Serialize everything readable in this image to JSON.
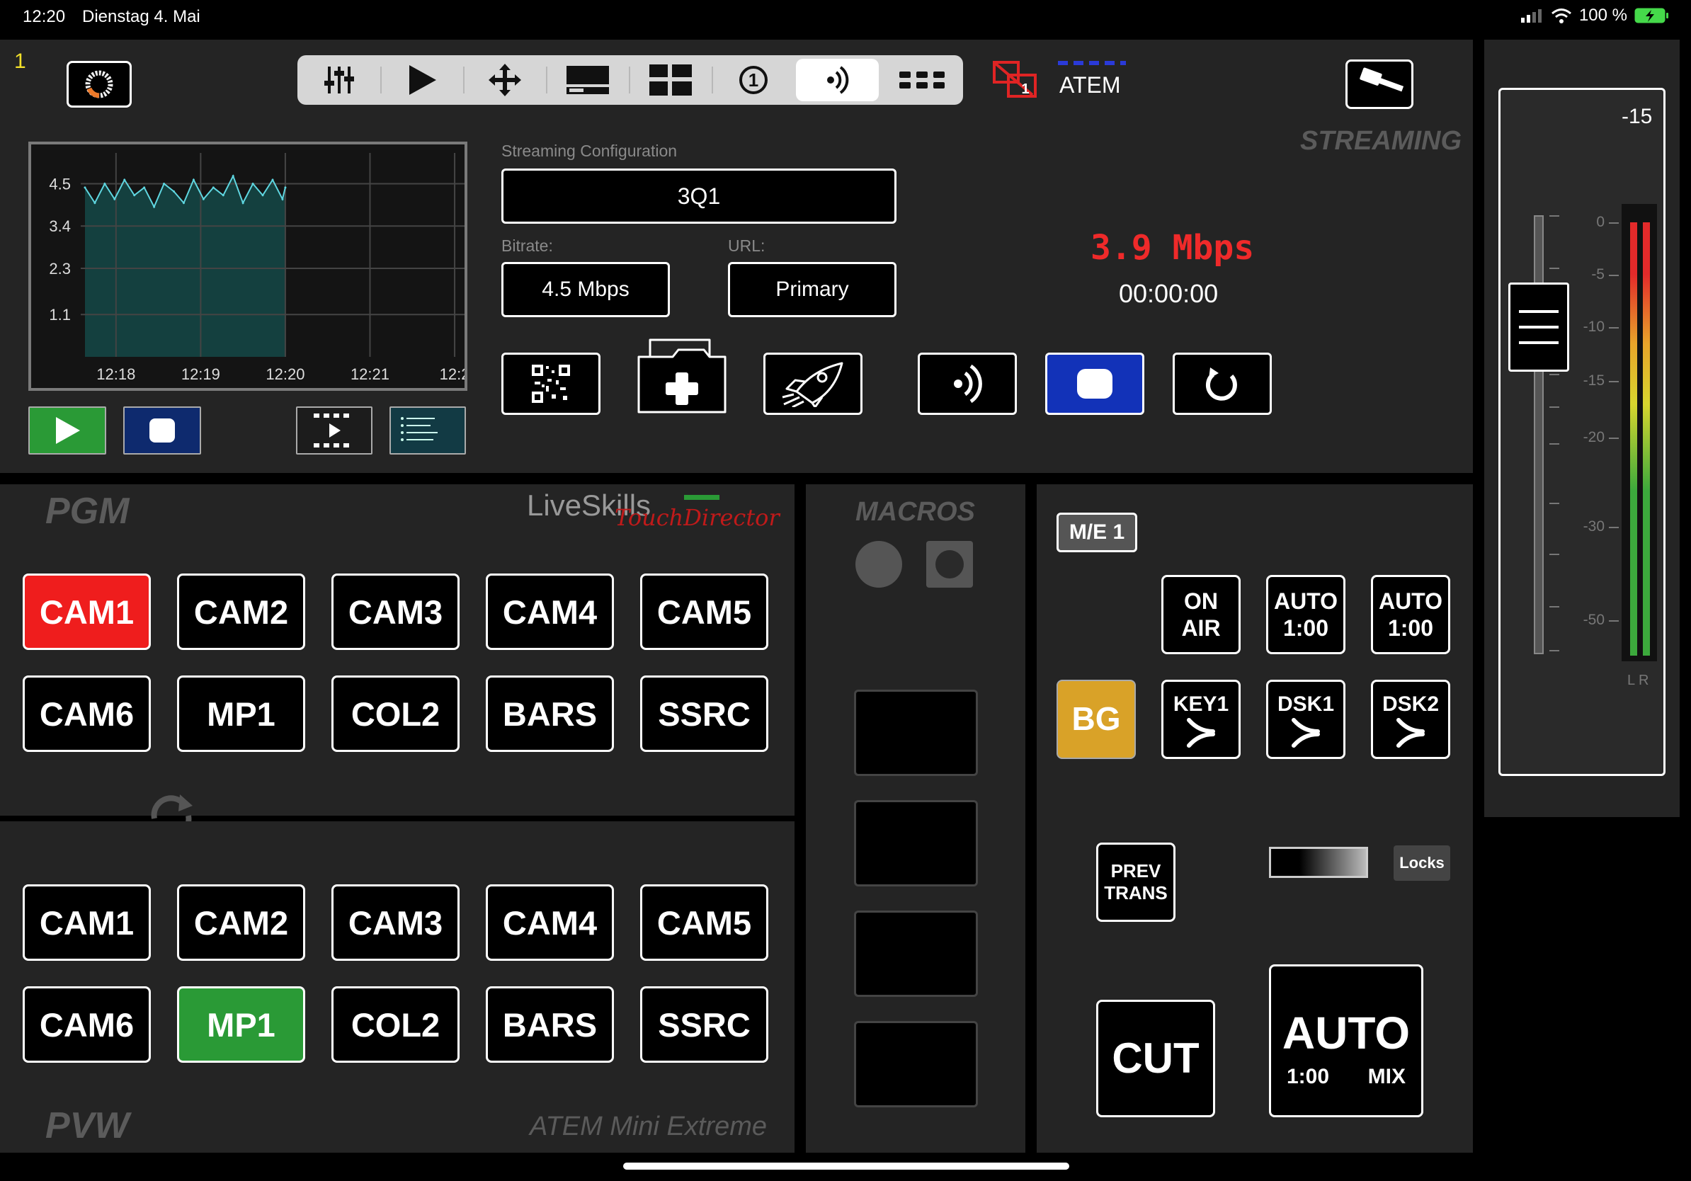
{
  "status_bar": {
    "time": "12:20",
    "date": "Dienstag 4. Mai",
    "battery": "100 %"
  },
  "top": {
    "page_number": "1",
    "device_name": "ATEM",
    "device_badge": "1",
    "section_title": "STREAMING"
  },
  "toolbar": {
    "items": [
      "mixer-icon",
      "play-icon",
      "move-icon",
      "monitor-icon",
      "multiview-icon",
      "one-circle-icon",
      "stream-icon",
      "more-icon"
    ],
    "active": "stream-icon",
    "one_label": "1"
  },
  "chart_data": {
    "type": "area",
    "title": "",
    "xlabel": "",
    "ylabel": "",
    "y_ticks": [
      "4.5",
      "3.4",
      "2.3",
      "1.1"
    ],
    "x_ticks": [
      "12:18",
      "12:19",
      "12:20",
      "12:21",
      "12:2"
    ],
    "ylim": [
      0,
      5.3
    ],
    "xlim": [
      "12:17:35",
      "12:22:05"
    ],
    "grid": true,
    "color": "#5fd6e0",
    "fill": "#14403f",
    "series": [
      {
        "x": [
          "12:17:38",
          "12:17:45",
          "12:17:52",
          "12:17:59",
          "12:18:06",
          "12:18:13",
          "12:18:20",
          "12:18:27",
          "12:18:34",
          "12:18:41",
          "12:18:48",
          "12:18:55",
          "12:19:02",
          "12:19:09",
          "12:19:16",
          "12:19:23",
          "12:19:30",
          "12:19:37",
          "12:19:44",
          "12:19:51",
          "12:19:58",
          "12:20:00"
        ],
        "values": [
          4.4,
          4.0,
          4.5,
          4.1,
          4.6,
          4.2,
          4.4,
          3.9,
          4.5,
          4.3,
          4.0,
          4.6,
          4.1,
          4.4,
          4.2,
          4.7,
          4.0,
          4.5,
          4.2,
          4.6,
          4.1,
          4.4
        ]
      }
    ]
  },
  "stream": {
    "config_label": "Streaming Configuration",
    "config_value": "3Q1",
    "bitrate_label": "Bitrate:",
    "bitrate_value": "4.5 Mbps",
    "url_label": "URL:",
    "url_value": "Primary",
    "current_rate": "3.9 Mbps",
    "duration": "00:00:00"
  },
  "colors": {
    "tally_red": "#ef1d1d",
    "preview_green": "#2a9a36",
    "bg_gold": "#d9a228",
    "record_blue": "#1232b8",
    "play_green": "#2a9a36"
  },
  "pgm": {
    "title": "PGM",
    "brand_main": "LiveSkills",
    "brand_sub": "TouchDirector",
    "sources": [
      "CAM1",
      "CAM2",
      "CAM3",
      "CAM4",
      "CAM5",
      "CAM6",
      "MP1",
      "COL2",
      "BARS",
      "SSRC"
    ],
    "active": "CAM1"
  },
  "pvw": {
    "title": "PVW",
    "model": "ATEM Mini Extreme",
    "sources": [
      "CAM1",
      "CAM2",
      "CAM3",
      "CAM4",
      "CAM5",
      "CAM6",
      "MP1",
      "COL2",
      "BARS",
      "SSRC"
    ],
    "active": "MP1"
  },
  "macros": {
    "title": "MACROS"
  },
  "me": {
    "label": "M/E 1",
    "on_air": [
      "ON",
      "AIR"
    ],
    "auto1": [
      "AUTO",
      "1:00"
    ],
    "auto2": [
      "AUTO",
      "1:00"
    ],
    "bg": "BG",
    "key1": "KEY1",
    "dsk1": "DSK1",
    "dsk2": "DSK2",
    "prev_trans": [
      "PREV",
      "TRANS"
    ],
    "locks": "Locks",
    "cut": "CUT",
    "auto": "AUTO",
    "auto_rate": "1:00",
    "auto_type": "MIX"
  },
  "audio": {
    "level_readout": "-15",
    "scale": [
      "0",
      "-5",
      "-10",
      "-15",
      "-20",
      "-30",
      "-50"
    ],
    "channels": "L R",
    "fader_level_db": -10
  }
}
